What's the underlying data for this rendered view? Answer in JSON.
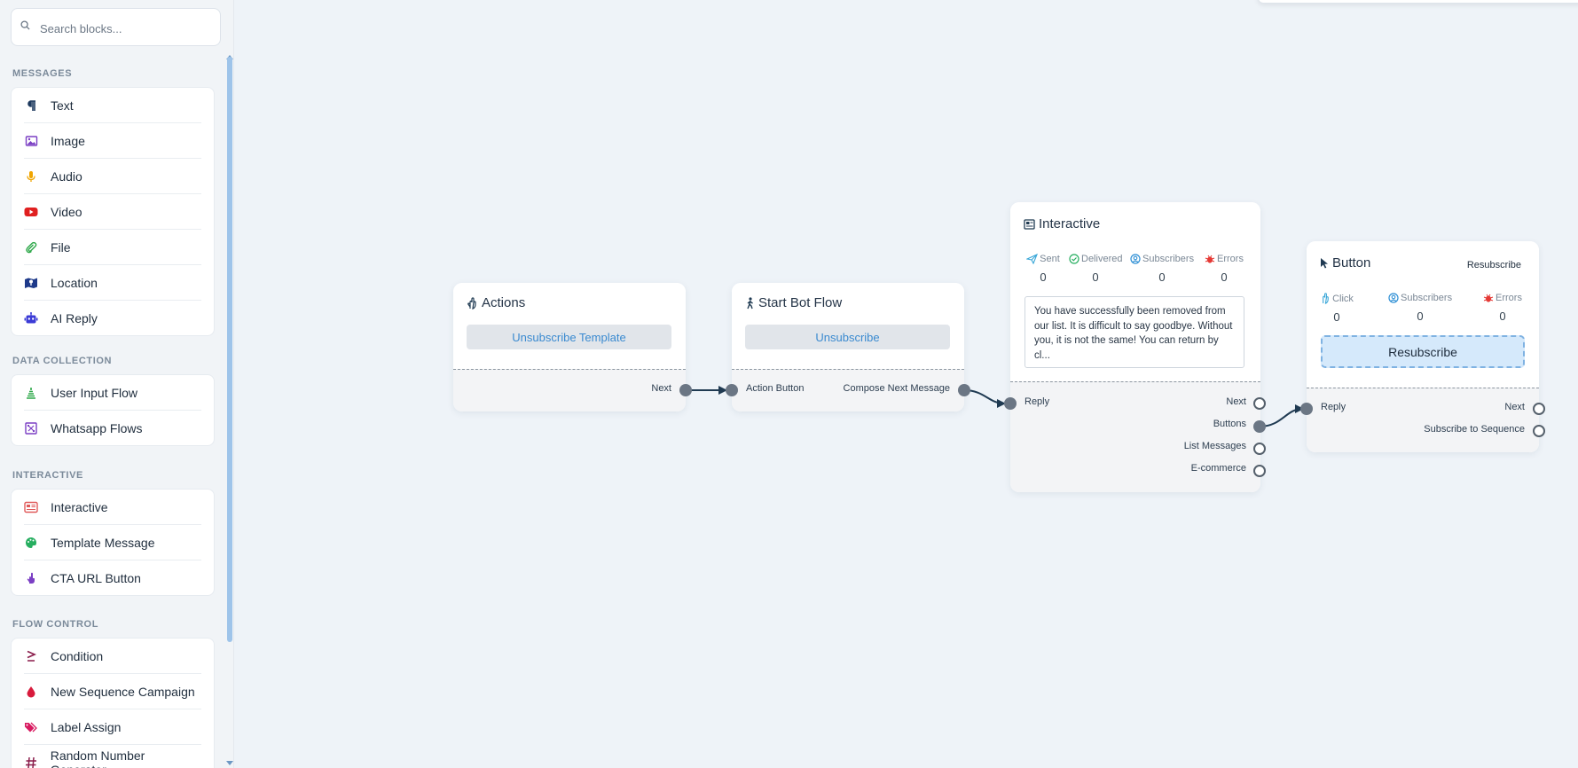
{
  "search": {
    "placeholder": "Search blocks..."
  },
  "sections": {
    "messages": "MESSAGES",
    "data_collection": "DATA COLLECTION",
    "interactive": "INTERACTIVE",
    "flow_control": "FLOW CONTROL"
  },
  "messages_items": [
    {
      "label": "Text",
      "icon": "paragraph-icon",
      "color": "#1e3a5f"
    },
    {
      "label": "Image",
      "icon": "image-icon",
      "color": "#7b3fc4"
    },
    {
      "label": "Audio",
      "icon": "microphone-icon",
      "color": "#f0a500"
    },
    {
      "label": "Video",
      "icon": "youtube-icon",
      "color": "#e02020"
    },
    {
      "label": "File",
      "icon": "paperclip-icon",
      "color": "#2ea84a"
    },
    {
      "label": "Location",
      "icon": "map-icon",
      "color": "#1e3a8a"
    },
    {
      "label": "AI Reply",
      "icon": "robot-icon",
      "color": "#3b3bd6"
    }
  ],
  "data_collection_items": [
    {
      "label": "User Input Flow",
      "icon": "layers-icon",
      "color": "#2ea84a"
    },
    {
      "label": "Whatsapp Flows",
      "icon": "flow-icon",
      "color": "#7b3fc4"
    }
  ],
  "interactive_items": [
    {
      "label": "Interactive",
      "icon": "newspaper-icon",
      "color": "#e05a5a"
    },
    {
      "label": "Template Message",
      "icon": "palette-icon",
      "color": "#27ae60"
    },
    {
      "label": "CTA URL Button",
      "icon": "pointer-hand-icon",
      "color": "#7b3fc4"
    }
  ],
  "flow_control_items": [
    {
      "label": "Condition",
      "icon": "greater-equal-icon",
      "color": "#8a1c4a"
    },
    {
      "label": "New Sequence Campaign",
      "icon": "drop-icon",
      "color": "#d81b3c"
    },
    {
      "label": "Label Assign",
      "icon": "tags-icon",
      "color": "#d81b60"
    },
    {
      "label": "Random Number Generator",
      "icon": "hash-icon",
      "color": "#8a1c4a"
    }
  ],
  "nodes": {
    "actions": {
      "title": "Actions",
      "button": "Unsubscribe Template",
      "out_next": "Next"
    },
    "start_bot_flow": {
      "title": "Start Bot Flow",
      "button": "Unsubscribe",
      "in_label": "Action Button",
      "out_label": "Compose Next Message"
    },
    "interactive": {
      "title": "Interactive",
      "stats": [
        {
          "label": "Sent",
          "value": "0",
          "icon": "send-icon",
          "color": "#3aa7d8"
        },
        {
          "label": "Delivered",
          "value": "0",
          "icon": "check-circle-icon",
          "color": "#27ae60"
        },
        {
          "label": "Subscribers",
          "value": "0",
          "icon": "user-circle-icon",
          "color": "#2d8fd5"
        },
        {
          "label": "Errors",
          "value": "0",
          "icon": "bug-icon",
          "color": "#e53935"
        }
      ],
      "message": "You have successfully been removed from our list. It is difficult to say goodbye. Without you, it is not the same! You can return by cl...",
      "in_label": "Reply",
      "outputs": [
        "Next",
        "Buttons",
        "List Messages",
        "E-commerce"
      ]
    },
    "button": {
      "title": "Button",
      "subtitle": "Resubscribe",
      "stats": [
        {
          "label": "Click",
          "value": "0",
          "icon": "hand-pointer-icon",
          "color": "#3aa7d8"
        },
        {
          "label": "Subscribers",
          "value": "0",
          "icon": "user-circle-icon",
          "color": "#2d8fd5"
        },
        {
          "label": "Errors",
          "value": "0",
          "icon": "bug-icon",
          "color": "#e53935"
        }
      ],
      "button": "Resubscribe",
      "in_label": "Reply",
      "outputs": [
        "Next",
        "Subscribe to Sequence"
      ]
    }
  }
}
